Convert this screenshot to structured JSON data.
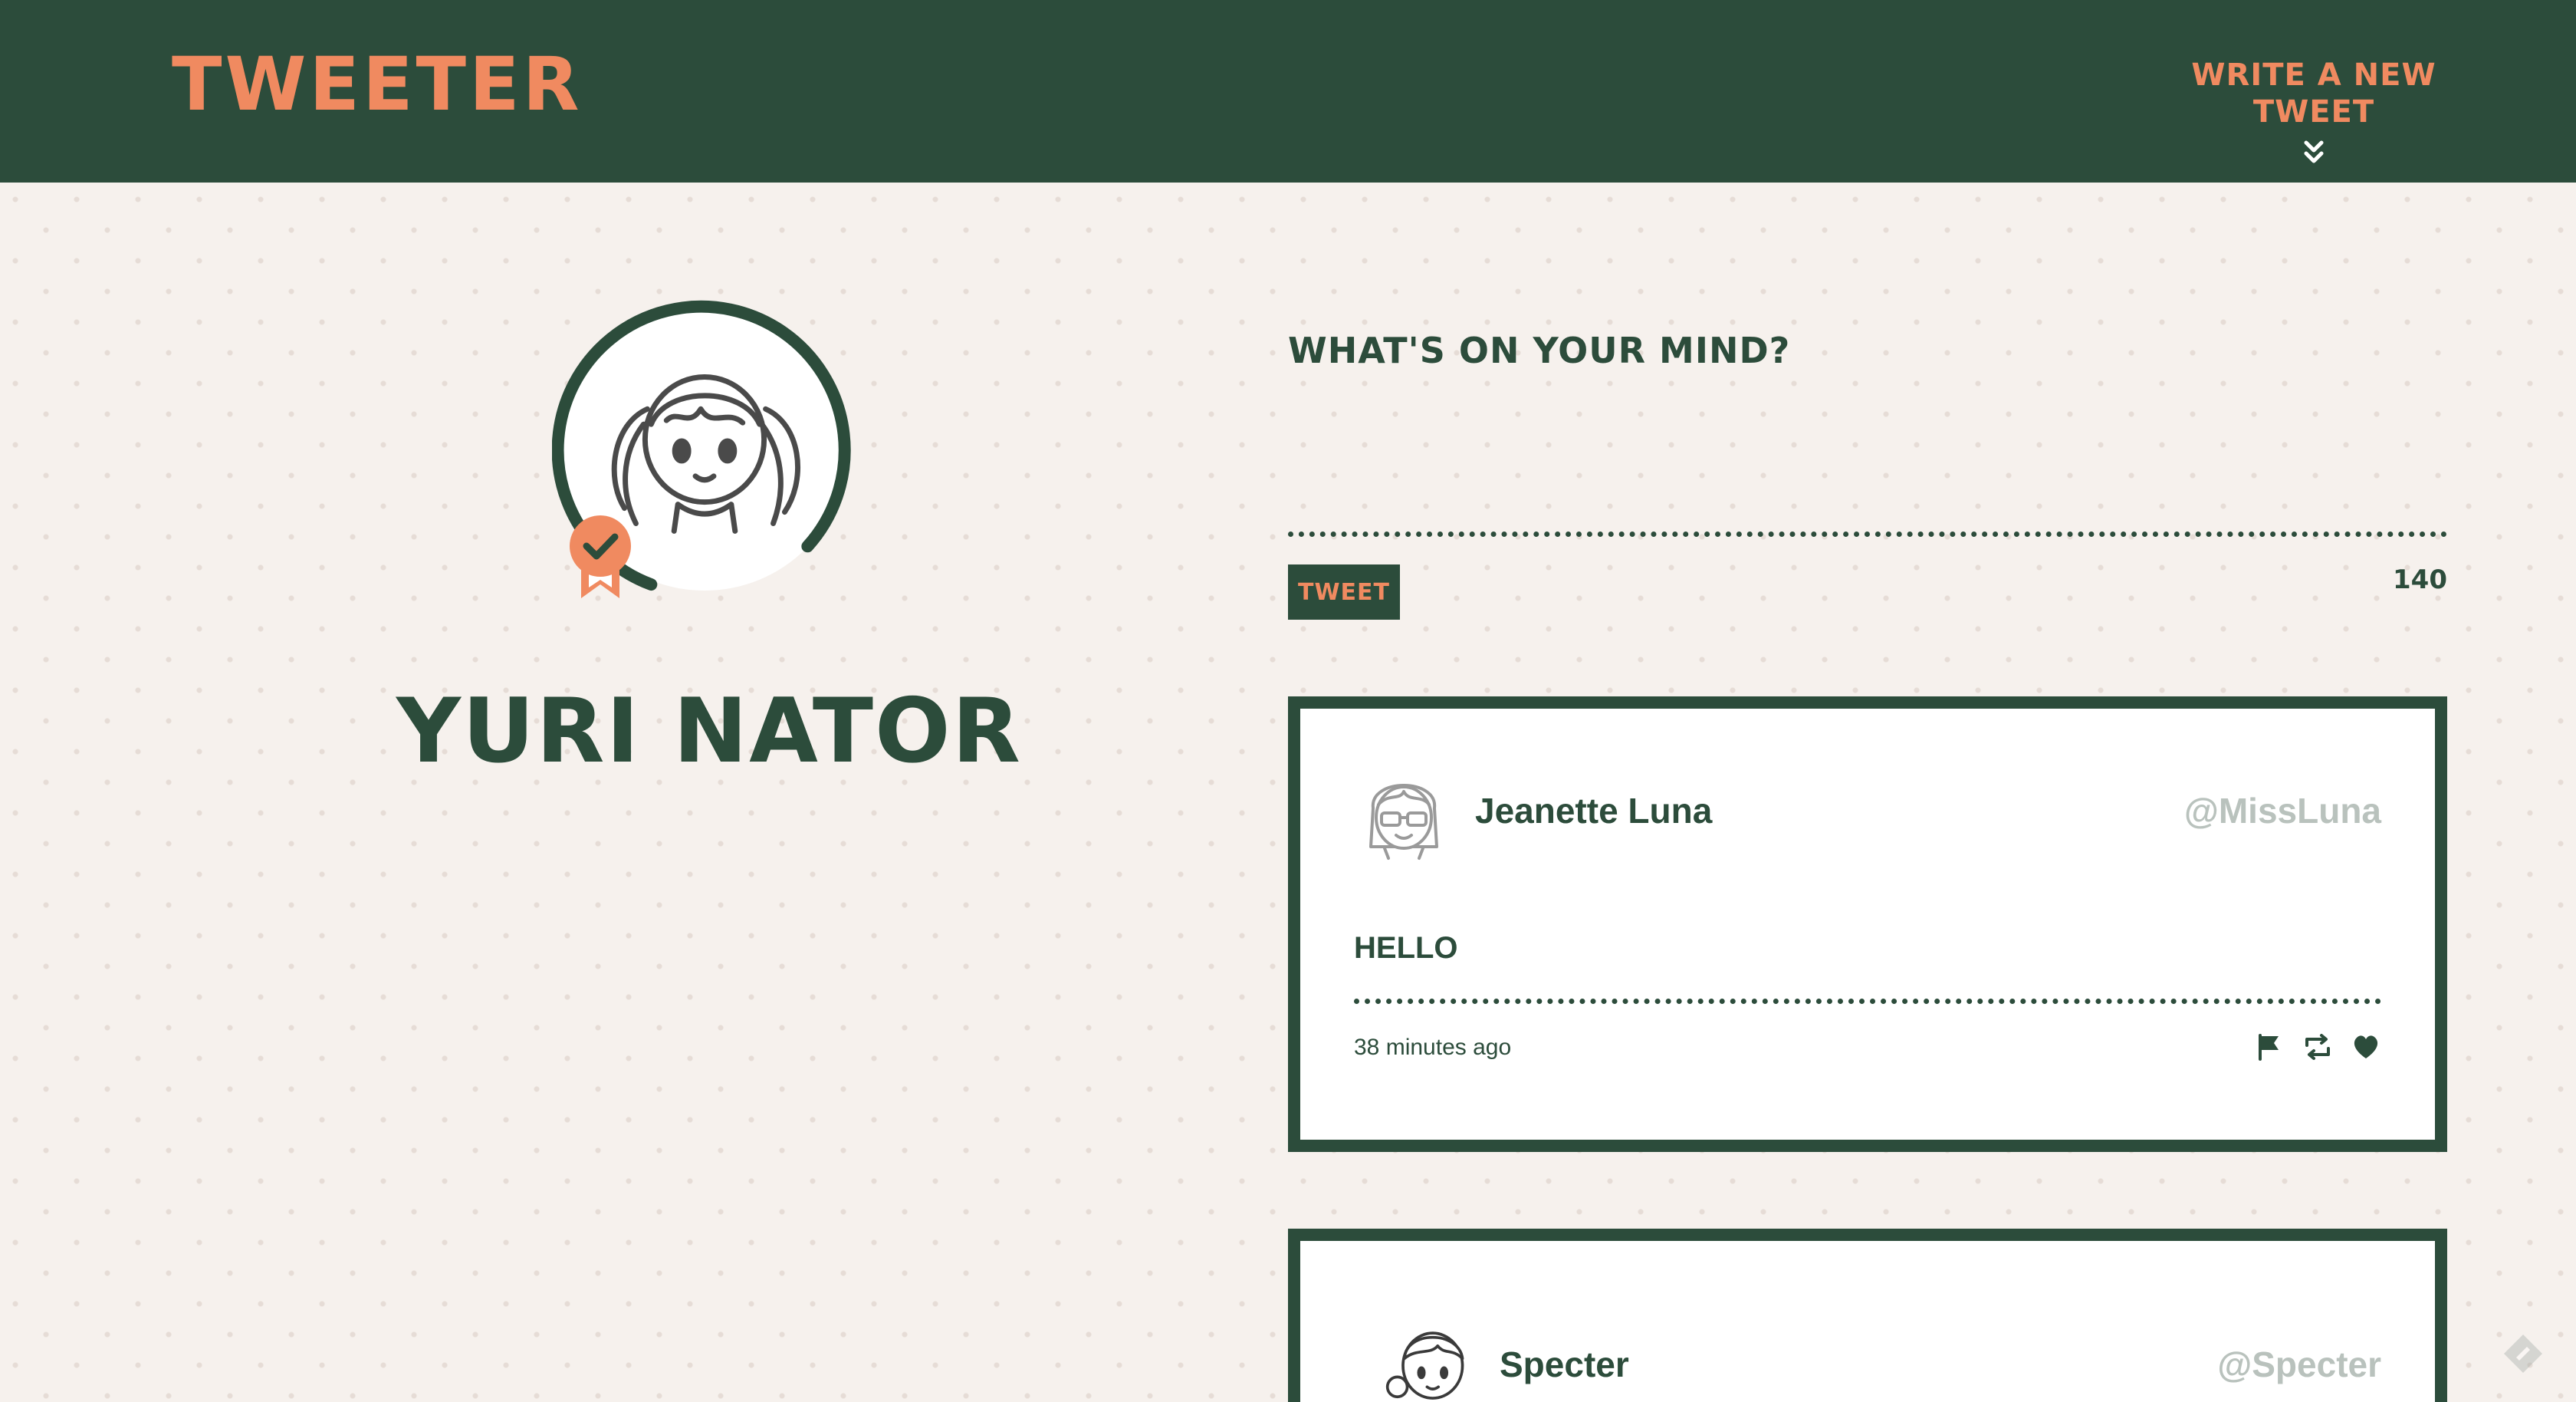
{
  "header": {
    "brand": "TWEETER",
    "compose_toggle_label": "WRITE A NEW TWEET",
    "compose_toggle_icon": "double-chevron-down-icon"
  },
  "profile": {
    "name": "YURI NATOR",
    "avatar_icon": "girl-avatar-icon",
    "badge_icon": "verified-ribbon-icon"
  },
  "compose": {
    "heading": "WHAT'S ON YOUR MIND?",
    "textarea_value": "",
    "button_label": "TWEET",
    "char_counter": "140"
  },
  "tweets": [
    {
      "name": "Jeanette Luna",
      "handle": "@MissLuna",
      "body": "HELLO",
      "time": "38 minutes ago",
      "avatar_icon": "girl-with-glasses-avatar-icon",
      "actions": [
        "flag-icon",
        "retweet-icon",
        "heart-icon"
      ]
    },
    {
      "name": "Specter",
      "handle": "@Specter",
      "avatar_icon": "boy-avatar-icon"
    }
  ],
  "colors": {
    "primary": "#2c4c3b",
    "accent": "#f08a60",
    "background": "#f6f1ed",
    "handle": "#b9c2bd"
  }
}
